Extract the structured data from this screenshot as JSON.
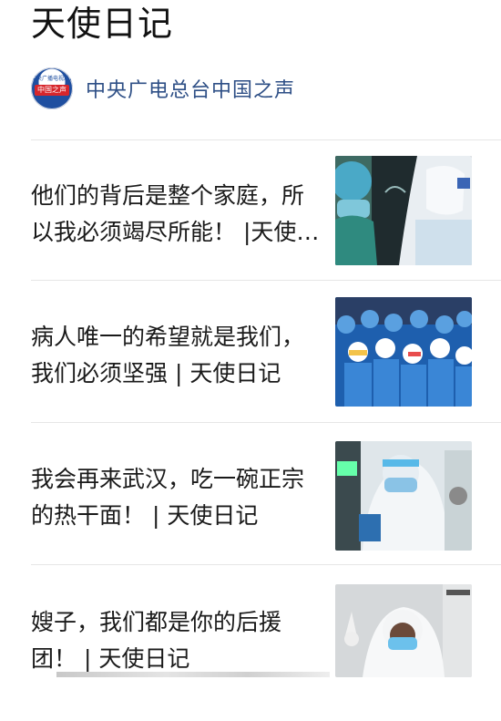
{
  "page": {
    "title": "天使日记"
  },
  "source": {
    "name": "中央广电总台中国之声",
    "logo_top": "中央广播电视总台",
    "logo_band": "中国之声"
  },
  "articles": [
    {
      "title": "他们的背后是整个家庭，所以我必须竭尽所能！ |天使日记"
    },
    {
      "title": "病人唯一的希望就是我们，我们必须坚强 | 天使日记"
    },
    {
      "title": "我会再来武汉，吃一碗正宗的热干面！ | 天使日记"
    },
    {
      "title": "嫂子，我们都是你的后援团！ | 天使日记"
    }
  ]
}
